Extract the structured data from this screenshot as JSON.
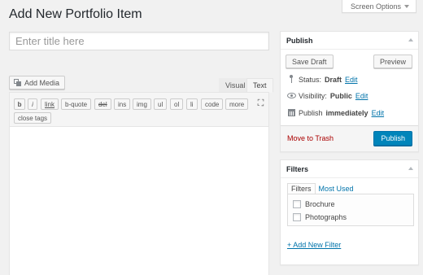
{
  "header": {
    "page_title": "Add New Portfolio Item",
    "screen_options_label": "Screen Options"
  },
  "editor": {
    "title_placeholder": "Enter title here",
    "add_media_label": "Add Media",
    "tabs": {
      "visual": "Visual",
      "text": "Text",
      "active": "Text"
    },
    "quicktags": [
      "b",
      "i",
      "link",
      "b-quote",
      "del",
      "ins",
      "img",
      "ul",
      "ol",
      "li",
      "code",
      "more",
      "close tags"
    ]
  },
  "publish": {
    "title": "Publish",
    "save_draft_label": "Save Draft",
    "preview_label": "Preview",
    "status_label": "Status:",
    "status_value": "Draft",
    "status_edit": "Edit",
    "visibility_label": "Visibility:",
    "visibility_value": "Public",
    "visibility_edit": "Edit",
    "publish_label": "Publish",
    "publish_value": "immediately",
    "publish_edit": "Edit",
    "trash_label": "Move to Trash",
    "publish_button_label": "Publish"
  },
  "filters": {
    "title": "Filters",
    "tabs": [
      "Filters",
      "Most Used"
    ],
    "items": [
      {
        "label": "Brochure",
        "checked": false
      },
      {
        "label": "Photographs",
        "checked": false
      }
    ],
    "add_new_label": "+ Add New Filter"
  },
  "colors": {
    "accent_blue": "#0085ba",
    "link_blue": "#0073aa",
    "trash_red": "#a00000",
    "background": "#f1f1f1"
  }
}
